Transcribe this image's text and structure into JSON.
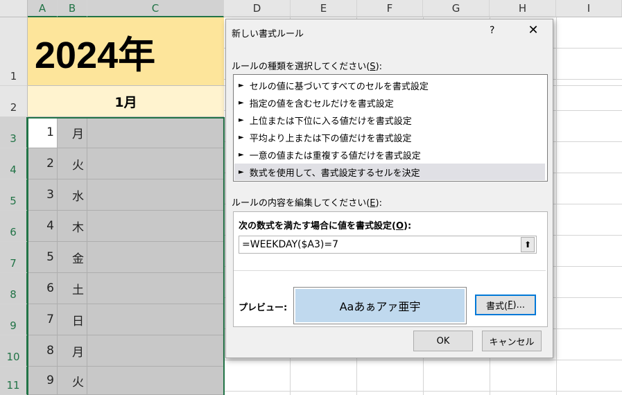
{
  "sheet": {
    "columns": [
      "A",
      "B",
      "C",
      "D",
      "E",
      "F",
      "G",
      "H",
      "I"
    ],
    "rows": [
      "1",
      "2",
      "3",
      "4",
      "5",
      "6",
      "7",
      "8",
      "9",
      "10",
      "11"
    ],
    "year_title": "2024年",
    "month_header": "1月",
    "days": [
      {
        "num": "1",
        "dow": "月"
      },
      {
        "num": "2",
        "dow": "火"
      },
      {
        "num": "3",
        "dow": "水"
      },
      {
        "num": "4",
        "dow": "木"
      },
      {
        "num": "5",
        "dow": "金"
      },
      {
        "num": "6",
        "dow": "土"
      },
      {
        "num": "7",
        "dow": "日"
      },
      {
        "num": "8",
        "dow": "月"
      },
      {
        "num": "9",
        "dow": "火"
      }
    ]
  },
  "dialog": {
    "title": "新しい書式ルール",
    "help": "?",
    "close": "✕",
    "rule_type_label_pre": "ルールの種類を選択してください(",
    "rule_type_label_key": "S",
    "rule_type_label_post": "):",
    "rule_arrow": "►",
    "rules": [
      "セルの値に基づいてすべてのセルを書式設定",
      "指定の値を含むセルだけを書式設定",
      "上位または下位に入る値だけを書式設定",
      "平均より上または下の値だけを書式設定",
      "一意の値または重複する値だけを書式設定",
      "数式を使用して、書式設定するセルを決定"
    ],
    "edit_label_pre": "ルールの内容を編集してください(",
    "edit_label_key": "E",
    "edit_label_post": "):",
    "formula_label_pre": "次の数式を満たす場合に値を書式設定(",
    "formula_label_key": "O",
    "formula_label_post": "):",
    "formula_value": "=WEEKDAY($A3)=7",
    "collapse_icon": "⬆",
    "preview_label": "プレビュー:",
    "preview_text": "Aaあぁアァ亜宇",
    "preview_color": "#c0d9ee",
    "format_button_pre": "書式(",
    "format_button_key": "F",
    "format_button_post": ")...",
    "ok_button": "OK",
    "cancel_button": "キャンセル"
  }
}
